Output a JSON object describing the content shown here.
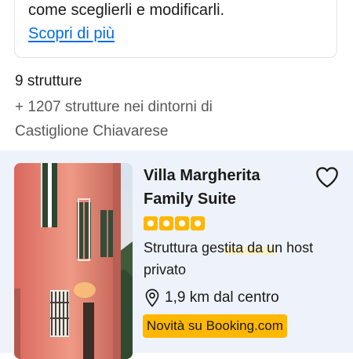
{
  "info_card": {
    "text": "come sceglierli e modificarli.",
    "link": "Scopri di più"
  },
  "results": {
    "count": "9 strutture",
    "nearby": "+ 1207 strutture nei dintorni di Castiglione Chiavarese"
  },
  "property": {
    "name": "Villa Margherita Family Suite",
    "stars": 4,
    "host_type_parts": [
      "Struttura ges",
      "tita da u",
      "n host privato"
    ],
    "distance": "1,9 km dal centro",
    "badge": "Novità su Booking.com",
    "favorite_icon": "heart-outline-icon",
    "location_icon": "map-pin-icon"
  },
  "colors": {
    "link": "#006ce4",
    "badge": "#ffb700",
    "result_background": "#eef3fb"
  }
}
